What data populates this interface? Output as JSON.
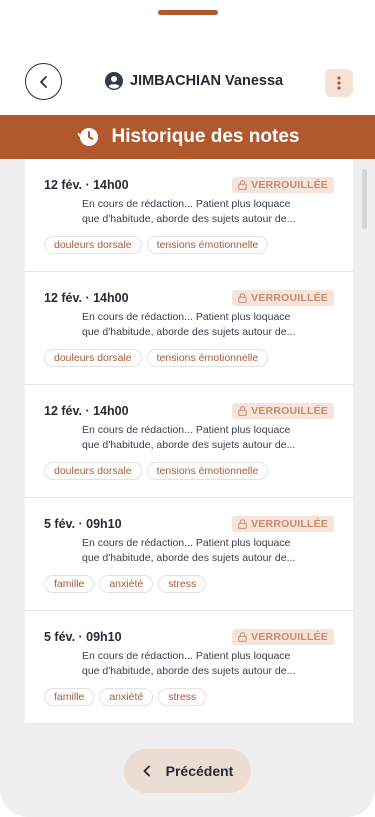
{
  "header": {
    "patient_name": "JIMBACHIAN Vanessa"
  },
  "title": "Historique des notes",
  "notes": [
    {
      "date": "12 fév. · 14h00",
      "status": "VERROUILLÉE",
      "preview_line1": "En cours de rédaction... Patient plus loquace",
      "preview_line2": "que d'habitude, aborde des sujets autour de...",
      "tags": [
        "douleurs dorsale",
        "tensions émotionnelle"
      ]
    },
    {
      "date": "12 fév. · 14h00",
      "status": "VERROUILLÉE",
      "preview_line1": "En cours de rédaction... Patient plus loquace",
      "preview_line2": "que d'habitude, aborde des sujets autour de...",
      "tags": [
        "douleurs dorsale",
        "tensions émotionnelle"
      ]
    },
    {
      "date": "12 fév. · 14h00",
      "status": "VERROUILLÉE",
      "preview_line1": "En cours de rédaction... Patient plus loquace",
      "preview_line2": "que d'habitude, aborde des sujets autour de...",
      "tags": [
        "douleurs dorsale",
        "tensions émotionnelle"
      ]
    },
    {
      "date": "5 fév. · 09h10",
      "status": "VERROUILLÉE",
      "preview_line1": "En cours de rédaction... Patient plus loquace",
      "preview_line2": "que d'habitude, aborde des sujets autour de...",
      "tags": [
        "famille",
        "anxiété",
        "stress"
      ]
    },
    {
      "date": "5 fév. · 09h10",
      "status": "VERROUILLÉE",
      "preview_line1": "En cours de rédaction... Patient plus loquace",
      "preview_line2": "que d'habitude, aborde des sujets autour de...",
      "tags": [
        "famille",
        "anxiété",
        "stress"
      ]
    }
  ],
  "footer": {
    "previous_label": "Précédent"
  },
  "colors": {
    "accent": "#b2582f",
    "badge_bg": "#f5e4dc",
    "badge_text": "#cc8a6c",
    "tag_text": "#a85a3a"
  },
  "icons": {
    "back": "chevron-left-icon",
    "user": "user-circle-icon",
    "menu": "more-vertical-icon",
    "history": "history-clock-icon",
    "lock": "lock-icon"
  }
}
